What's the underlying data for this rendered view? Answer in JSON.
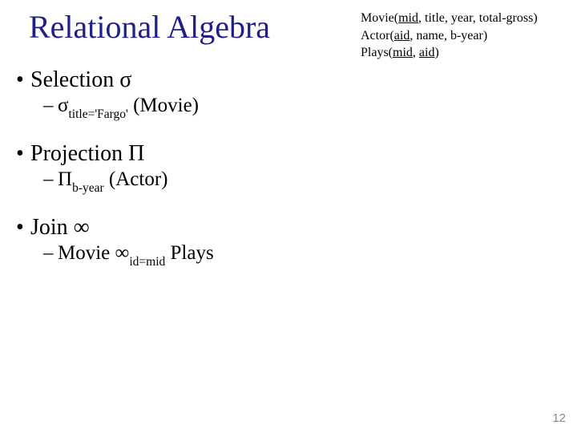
{
  "title": "Relational Algebra",
  "schemas": {
    "movie": {
      "rel": "Movie",
      "key": "mid",
      "rest": ", title, year, total-gross)"
    },
    "actor": {
      "rel": "Actor",
      "key": "aid",
      "rest": ", name, b-year)"
    },
    "plays": {
      "rel": "Plays",
      "key1": "mid",
      "sep": ", ",
      "key2": "aid",
      "close": ")"
    }
  },
  "sel": {
    "label_pre": "Selection ",
    "sigma": "σ",
    "ex_sigma": "σ",
    "ex_sub": "title='Fargo'",
    "ex_post": " (Movie)"
  },
  "proj": {
    "label_pre": "Projection ",
    "pi": "Π",
    "ex_pi": "Π",
    "ex_sub": "b-year",
    "ex_post": "  (Actor)"
  },
  "join": {
    "label_pre": "Join ",
    "sym": "∞",
    "ex_pre": "Movie ",
    "ex_sym": "∞",
    "ex_sub": "id=mid",
    "ex_post": " Plays"
  },
  "glyph": {
    "bullet": "•",
    "dash": "–"
  },
  "page": "12"
}
